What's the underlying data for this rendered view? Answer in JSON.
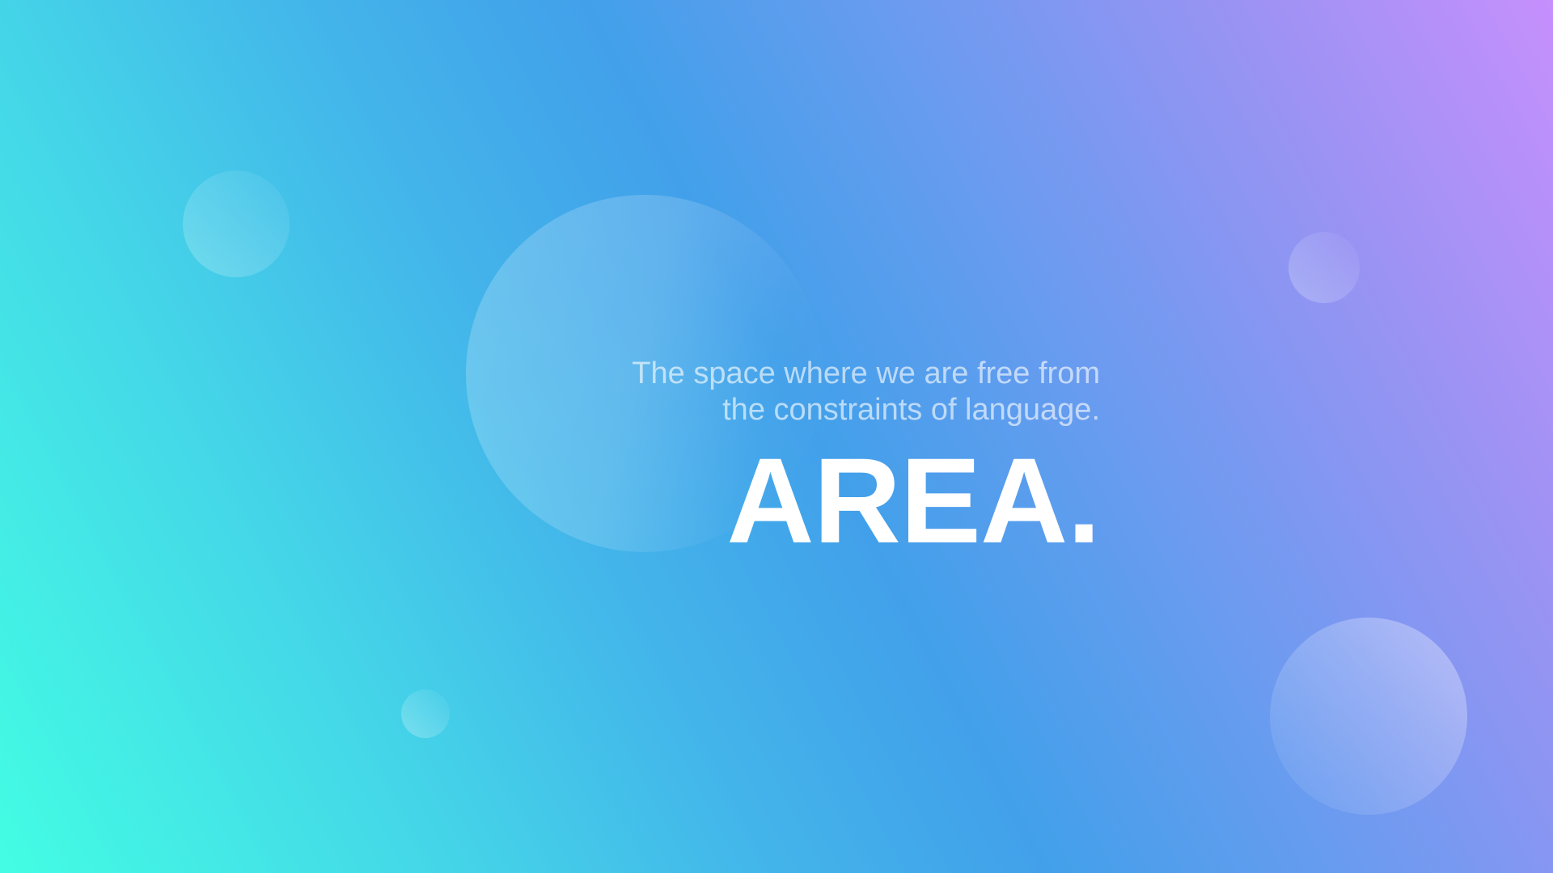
{
  "hero": {
    "tagline_line1": "The space where we are free from",
    "tagline_line2": "the constraints of language.",
    "title": "AREA."
  },
  "colors": {
    "gradient_start": "#43fde3",
    "gradient_mid": "#42a0ea",
    "gradient_end": "#c68ffc",
    "text": "#ffffff"
  }
}
